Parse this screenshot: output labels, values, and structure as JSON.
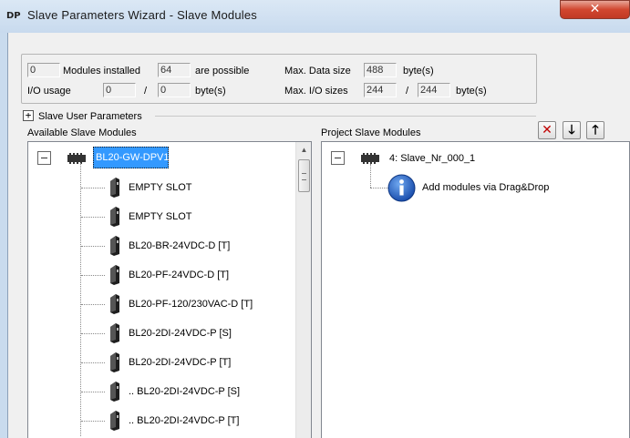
{
  "window": {
    "app_icon_text": "DP",
    "title": "Slave Parameters Wizard - Slave Modules",
    "close_glyph": "✕"
  },
  "info": {
    "modules_installed_value": "0",
    "modules_installed_label": "Modules installed",
    "possible_value": "64",
    "possible_label": "are possible",
    "max_data_size_label": "Max. Data size",
    "max_data_size_value": "488",
    "max_data_size_unit": "byte(s)",
    "io_usage_label": "I/O usage",
    "io_usage_in": "0",
    "io_usage_sep": "/",
    "io_usage_out": "0",
    "io_usage_unit": "byte(s)",
    "max_io_sizes_label": "Max. I/O sizes",
    "max_io_in": "244",
    "max_io_sep": "/",
    "max_io_out": "244",
    "max_io_unit": "byte(s)"
  },
  "user_params": {
    "expander": "+",
    "label": "Slave User Parameters"
  },
  "available": {
    "header": "Available Slave Modules",
    "root_label": "BL20-GW-DPV1",
    "items": [
      "EMPTY SLOT",
      "EMPTY SLOT",
      "BL20-BR-24VDC-D  [T]",
      "BL20-PF-24VDC-D  [T]",
      "BL20-PF-120/230VAC-D  [T]",
      "BL20-2DI-24VDC-P  [S]",
      "BL20-2DI-24VDC-P  [T]",
      ".. BL20-2DI-24VDC-P  [S]",
      ".. BL20-2DI-24VDC-P  [T]"
    ]
  },
  "project": {
    "header": "Project Slave Modules",
    "root_label": "4: Slave_Nr_000_1",
    "hint": "Add modules via Drag&Drop"
  },
  "toolbar": {
    "delete_glyph": "✕",
    "down_glyph": "🡓",
    "up_glyph": "🡑"
  },
  "colors": {
    "selection": "#3399ff",
    "delete_red": "#c00000",
    "info_blue": "#1f5fcf"
  }
}
